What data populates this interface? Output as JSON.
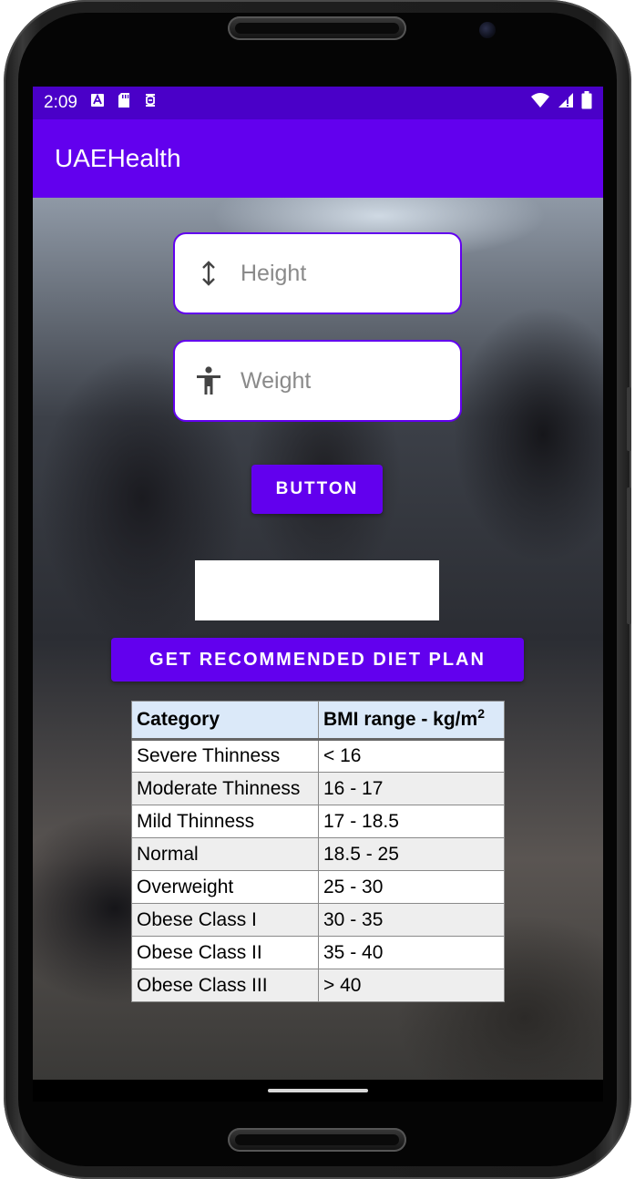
{
  "status_bar": {
    "time": "2:09",
    "left_icons": [
      "font-icon",
      "sd-card-icon",
      "debug-icon"
    ],
    "right_icons": [
      "wifi-icon",
      "signal-icon",
      "battery-icon"
    ]
  },
  "app_bar": {
    "title": "UAEHealth"
  },
  "form": {
    "height": {
      "placeholder": "Height",
      "value": "",
      "icon": "vertical-arrows-icon"
    },
    "weight": {
      "placeholder": "Weight",
      "value": "",
      "icon": "person-icon"
    },
    "submit_label": "BUTTON",
    "result_text": "",
    "diet_plan_label": "GET RECOMMENDED DIET PLAN"
  },
  "bmi_table": {
    "header_category": "Category",
    "header_range": "BMI range - kg/m",
    "header_range_sup": "2",
    "rows": [
      {
        "category": "Severe Thinness",
        "range": "< 16"
      },
      {
        "category": "Moderate Thinness",
        "range": "16 - 17"
      },
      {
        "category": "Mild Thinness",
        "range": "17 - 18.5"
      },
      {
        "category": "Normal",
        "range": "18.5 - 25"
      },
      {
        "category": "Overweight",
        "range": "25 - 30"
      },
      {
        "category": "Obese Class I",
        "range": "30 - 35"
      },
      {
        "category": "Obese Class II",
        "range": "35 - 40"
      },
      {
        "category": "Obese Class III",
        "range": "> 40"
      }
    ]
  },
  "colors": {
    "primary": "#6200ee",
    "status_bar": "#4a00c8",
    "table_header": "#dbe9f9",
    "table_stripe": "#eeeeee"
  }
}
